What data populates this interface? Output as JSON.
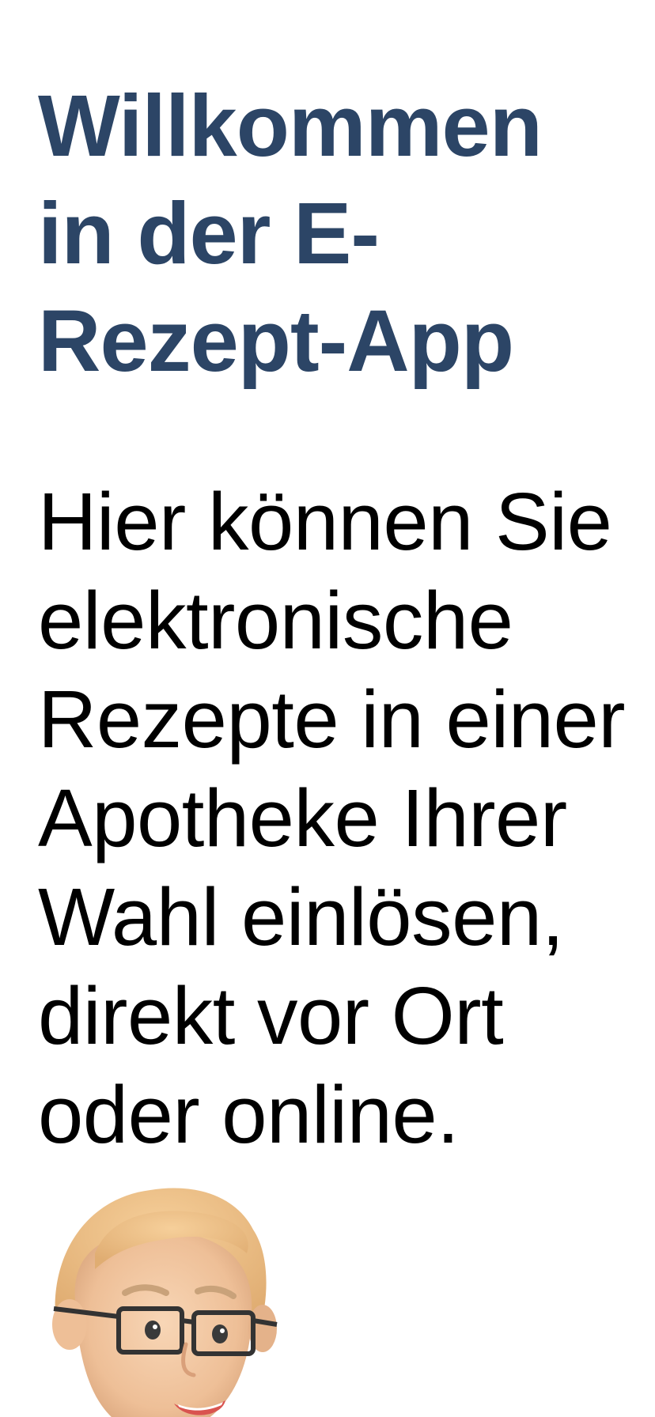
{
  "welcome": {
    "title_lines": [
      "Willkommen",
      "in der E-",
      "Rezept-App"
    ],
    "body_lines": [
      "Hier können Sie",
      "elektronische",
      "Rezepte in einer",
      "Apotheke Ihrer",
      "Wahl einlösen,",
      "direkt vor Ort",
      "oder online."
    ],
    "illustration": "pharmacist-avatar-illustration"
  },
  "colors": {
    "title": "#2c4566",
    "body": "#000000",
    "background": "#ffffff"
  }
}
